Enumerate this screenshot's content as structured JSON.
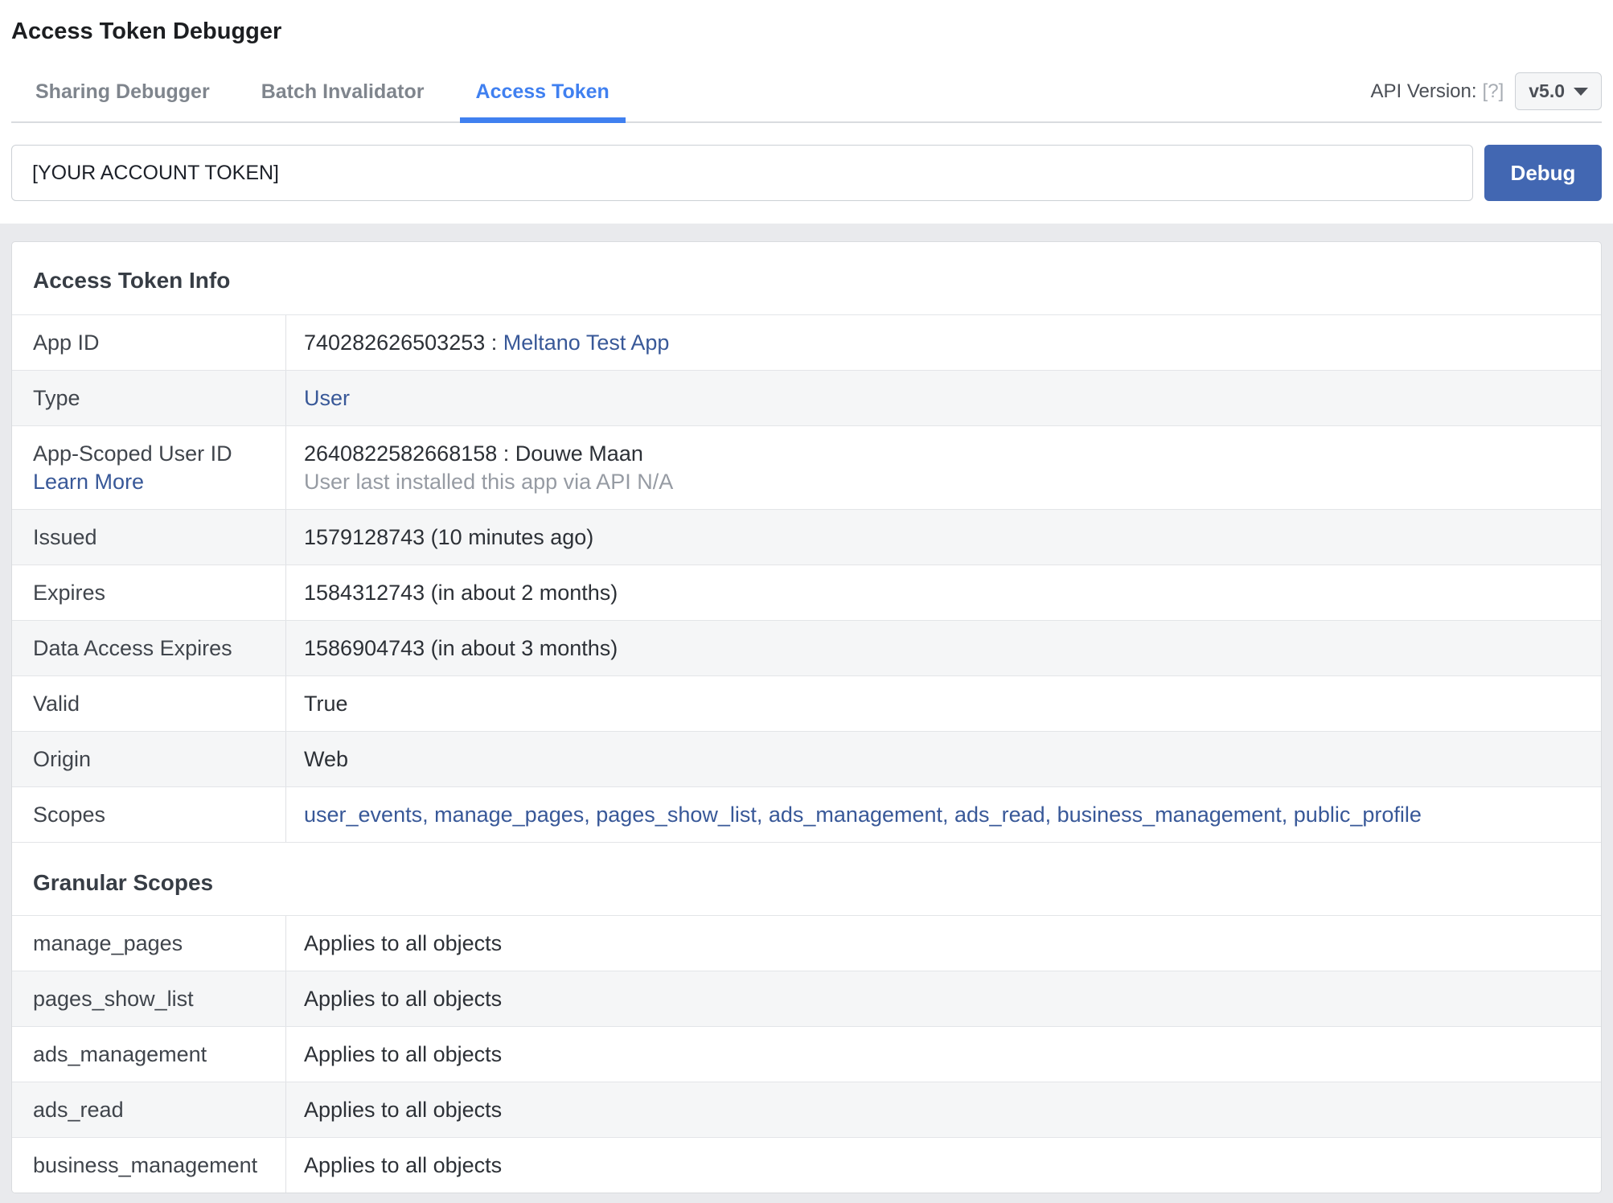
{
  "header": {
    "title": "Access Token Debugger"
  },
  "tabs": [
    {
      "label": "Sharing Debugger",
      "active": false
    },
    {
      "label": "Batch Invalidator",
      "active": false
    },
    {
      "label": "Access Token",
      "active": true
    }
  ],
  "api_version": {
    "label": "API Version:",
    "help": "[?]",
    "value": "v5.0"
  },
  "token_input": {
    "value": "[YOUR ACCOUNT TOKEN]"
  },
  "debug_button_label": "Debug",
  "token_info": {
    "title": "Access Token Info",
    "rows": {
      "app_id": {
        "label": "App ID",
        "value_plain": "740282626503253 : ",
        "value_link": "Meltano Test App"
      },
      "type": {
        "label": "Type",
        "value_link": "User"
      },
      "asuid": {
        "label": "App-Scoped User ID",
        "label_link": "Learn More",
        "value_plain": "2640822582668158 : Douwe Maan",
        "value_note": "User last installed this app via API N/A"
      },
      "issued": {
        "label": "Issued",
        "value_plain": "1579128743 (10 minutes ago)"
      },
      "expires": {
        "label": "Expires",
        "value_plain": "1584312743 (in about 2 months)"
      },
      "data_access_expires": {
        "label": "Data Access Expires",
        "value_plain": "1586904743 (in about 3 months)"
      },
      "valid": {
        "label": "Valid",
        "value_plain": "True"
      },
      "origin": {
        "label": "Origin",
        "value_plain": "Web"
      },
      "scopes": {
        "label": "Scopes",
        "value_links": "user_events, manage_pages, pages_show_list, ads_management, ads_read, business_management, public_profile"
      }
    }
  },
  "granular": {
    "title": "Granular Scopes",
    "rows": [
      {
        "label": "manage_pages",
        "value": "Applies to all objects"
      },
      {
        "label": "pages_show_list",
        "value": "Applies to all objects"
      },
      {
        "label": "ads_management",
        "value": "Applies to all objects"
      },
      {
        "label": "ads_read",
        "value": "Applies to all objects"
      },
      {
        "label": "business_management",
        "value": "Applies to all objects"
      }
    ]
  },
  "colors": {
    "accent": "#4080f0",
    "link": "#385898",
    "button": "#4267b2"
  }
}
